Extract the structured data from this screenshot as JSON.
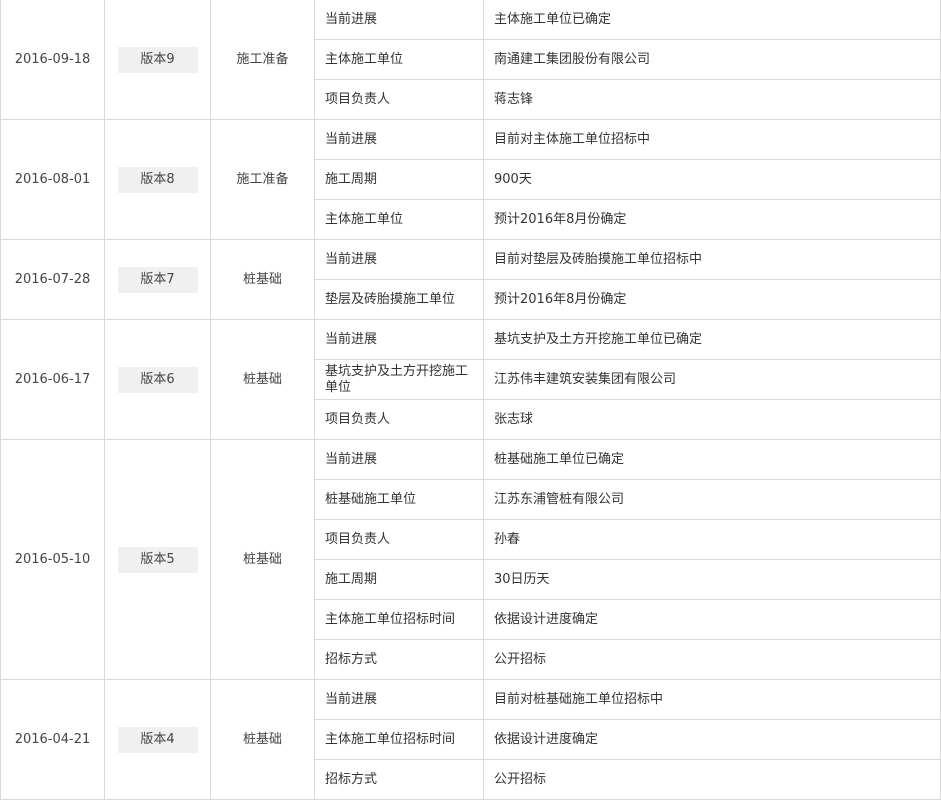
{
  "versions": [
    {
      "date": "2016-09-18",
      "version": "版本9",
      "stage": "施工准备",
      "details": [
        {
          "field": "当前进展",
          "value": "主体施工单位已确定"
        },
        {
          "field": "主体施工单位",
          "value": "南通建工集团股份有限公司"
        },
        {
          "field": "项目负责人",
          "value": "蒋志锋"
        }
      ]
    },
    {
      "date": "2016-08-01",
      "version": "版本8",
      "stage": "施工准备",
      "details": [
        {
          "field": "当前进展",
          "value": "目前对主体施工单位招标中"
        },
        {
          "field": "施工周期",
          "value": "900天"
        },
        {
          "field": "主体施工单位",
          "value": "预计2016年8月份确定"
        }
      ]
    },
    {
      "date": "2016-07-28",
      "version": "版本7",
      "stage": "桩基础",
      "details": [
        {
          "field": "当前进展",
          "value": "目前对垫层及砖胎摸施工单位招标中"
        },
        {
          "field": "垫层及砖胎摸施工单位",
          "value": "预计2016年8月份确定"
        }
      ]
    },
    {
      "date": "2016-06-17",
      "version": "版本6",
      "stage": "桩基础",
      "details": [
        {
          "field": "当前进展",
          "value": "基坑支护及土方开挖施工单位已确定"
        },
        {
          "field": "基坑支护及土方开挖施工单位",
          "value": "江苏伟丰建筑安装集团有限公司"
        },
        {
          "field": "项目负责人",
          "value": "张志球"
        }
      ]
    },
    {
      "date": "2016-05-10",
      "version": "版本5",
      "stage": "桩基础",
      "details": [
        {
          "field": "当前进展",
          "value": "桩基础施工单位已确定"
        },
        {
          "field": "桩基础施工单位",
          "value": "江苏东浦管桩有限公司"
        },
        {
          "field": "项目负责人",
          "value": "孙春"
        },
        {
          "field": "施工周期",
          "value": "30日历天"
        },
        {
          "field": "主体施工单位招标时间",
          "value": "依据设计进度确定"
        },
        {
          "field": "招标方式",
          "value": "公开招标"
        }
      ]
    },
    {
      "date": "2016-04-21",
      "version": "版本4",
      "stage": "桩基础",
      "details": [
        {
          "field": "当前进展",
          "value": "目前对桩基础施工单位招标中"
        },
        {
          "field": "主体施工单位招标时间",
          "value": "依据设计进度确定"
        },
        {
          "field": "招标方式",
          "value": "公开招标"
        }
      ]
    }
  ]
}
